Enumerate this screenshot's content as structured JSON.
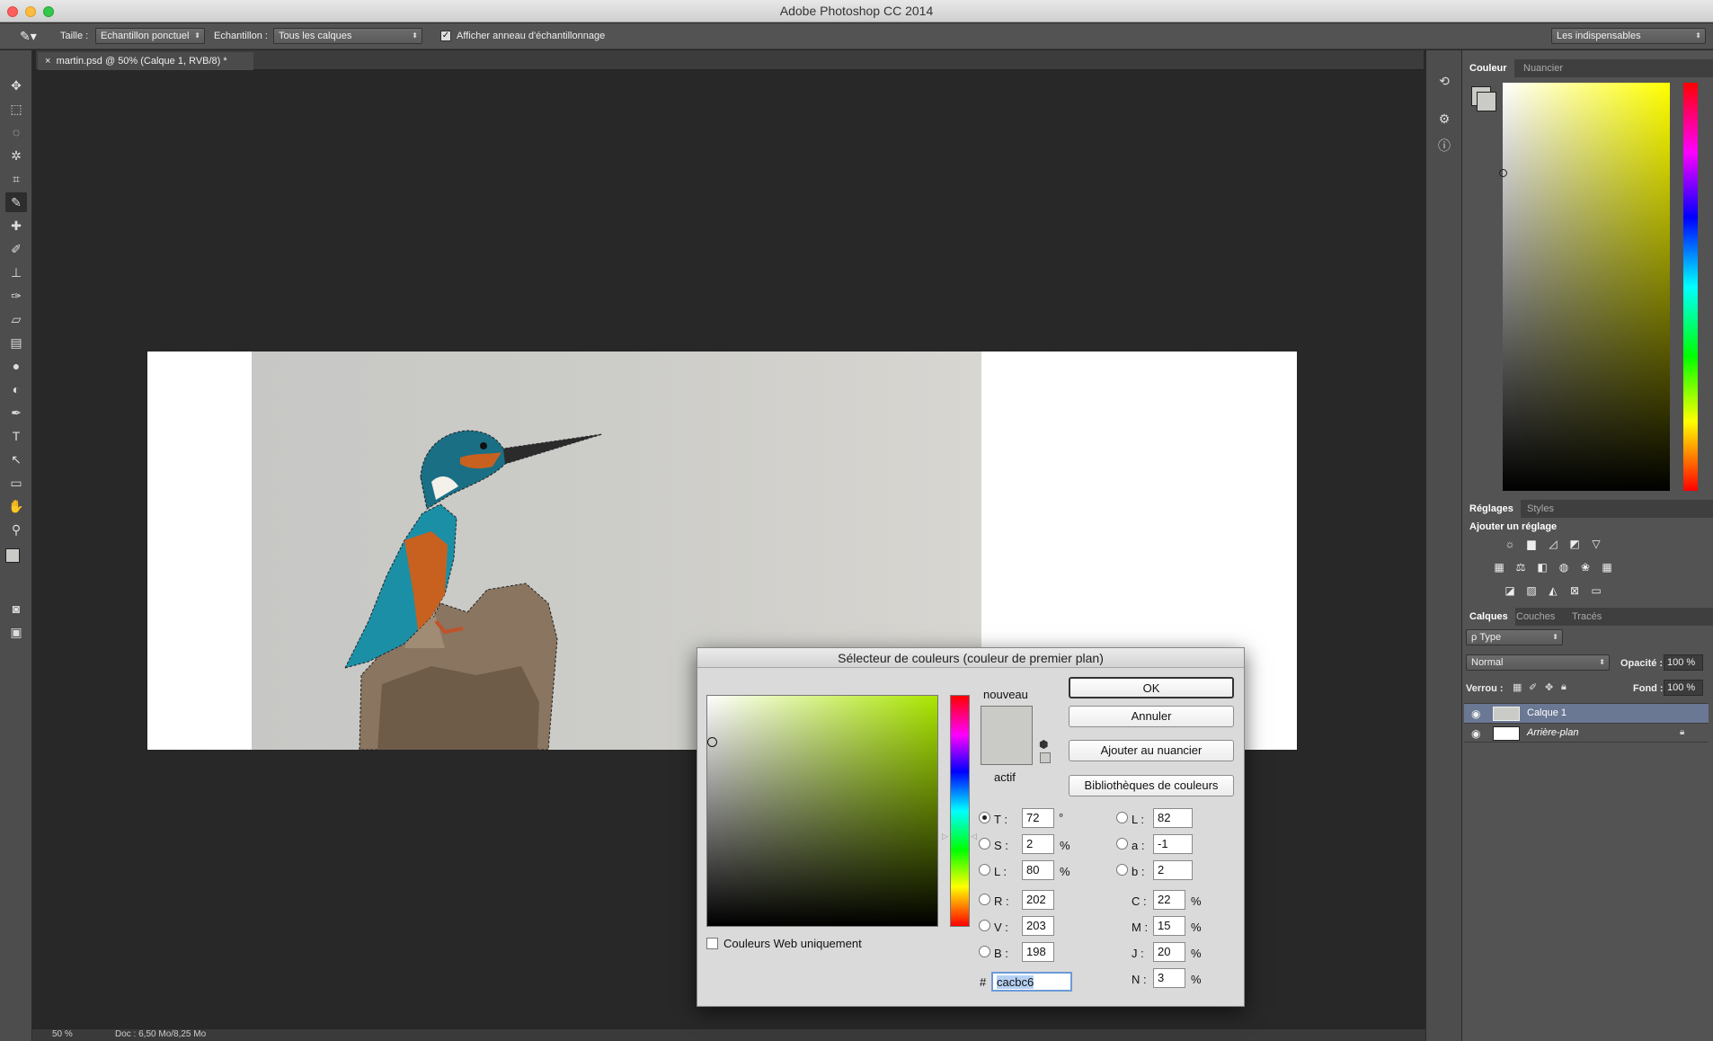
{
  "app": {
    "title": "Adobe Photoshop CC 2014"
  },
  "options_bar": {
    "size_label": "Taille :",
    "size_value": "Echantillon ponctuel",
    "sample_label": "Echantillon :",
    "sample_value": "Tous les calques",
    "ring_label": "Afficher anneau d'échantillonnage",
    "workspace": "Les indispensables"
  },
  "document": {
    "tab_title": "martin.psd @ 50% (Calque 1, RVB/8) *",
    "close_glyph": "×"
  },
  "status": {
    "zoom": "50 %",
    "doc": "Doc : 6,50 Mo/8,25 Mo"
  },
  "color_panel": {
    "tabs": [
      "Couleur",
      "Nuancier"
    ]
  },
  "adjust_panel": {
    "tabs": [
      "Réglages",
      "Styles"
    ],
    "heading": "Ajouter un réglage"
  },
  "layers_panel": {
    "tabs": [
      "Calques",
      "Couches",
      "Tracés"
    ],
    "filter": "ρ Type",
    "blend_mode": "Normal",
    "opacity_label": "Opacité :",
    "opacity_value": "100 %",
    "lock_label": "Verrou :",
    "fill_label": "Fond :",
    "fill_value": "100 %",
    "layers": [
      {
        "name": "Calque 1",
        "selected": true
      },
      {
        "name": "Arrière-plan",
        "selected": false
      }
    ]
  },
  "color_picker": {
    "title": "Sélecteur de couleurs (couleur de premier plan)",
    "new_label": "nouveau",
    "current_label": "actif",
    "new_color": "#cacbc6",
    "current_color": "#cacbc6",
    "buttons": {
      "ok": "OK",
      "cancel": "Annuler",
      "add_swatch": "Ajouter au nuancier",
      "libraries": "Bibliothèques de couleurs"
    },
    "web_only_label": "Couleurs Web uniquement",
    "hsb": {
      "T": "72",
      "S": "2",
      "L": "80",
      "t_unit": "°",
      "s_unit": "%",
      "l_unit": "%"
    },
    "rgb": {
      "R": "202",
      "V": "203",
      "B": "198"
    },
    "lab": {
      "L": "82",
      "a": "-1",
      "b": "2"
    },
    "cmyk": {
      "C": "22",
      "M": "15",
      "J": "20",
      "N": "3",
      "unit": "%"
    },
    "hex_label": "#",
    "hex": "cacbc6",
    "field_labels": {
      "T": "T :",
      "S": "S :",
      "L": "L :",
      "R": "R :",
      "V": "V :",
      "B": "B :",
      "LabL": "L :",
      "a": "a :",
      "b": "b :",
      "C": "C :",
      "M": "M :",
      "J": "J :",
      "N": "N :"
    }
  }
}
